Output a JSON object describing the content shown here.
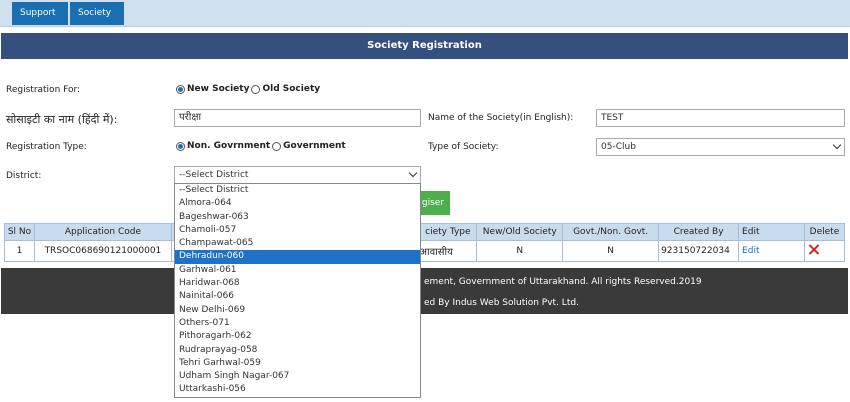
{
  "nav": {
    "support": "Support",
    "society": "Society"
  },
  "page_title": "Society Registration",
  "form": {
    "registration_for_label": "Registration For:",
    "registration_for_options": [
      "New Society",
      "Old Society"
    ],
    "registration_for_selected": "New Society",
    "name_hindi_label": "सोसाइटी का नाम (हिंदी में):",
    "name_hindi_value": "परीक्षा",
    "name_english_label": "Name of the Society(in English):",
    "name_english_value": "TEST",
    "registration_type_label": "Registration Type:",
    "registration_type_options": [
      "Non. Govrnment",
      "Government"
    ],
    "registration_type_selected": "Non. Govrnment",
    "type_of_society_label": "Type of Society:",
    "type_of_society_value": "05-Club",
    "district_label": "District:",
    "district_value": "--Select District",
    "register_button": "giser"
  },
  "district_options": [
    "--Select District",
    "Almora-064",
    "Bageshwar-063",
    "Chamoli-057",
    "Champawat-065",
    "Dehradun-060",
    "Garhwal-061",
    "Haridwar-068",
    "Nainital-066",
    "New Delhi-069",
    "Others-071",
    "Pithoragarh-062",
    "Rudraprayag-058",
    "Tehri Garhwal-059",
    "Udham Singh Nagar-067",
    "Uttarkashi-056"
  ],
  "district_highlighted": "Dehradun-060",
  "table": {
    "headers": [
      "Sl No",
      "Application Code",
      "",
      "ciety Type",
      "New/Old Society",
      "Govt./Non. Govt.",
      "Created By",
      "Edit",
      "Delete"
    ],
    "rows": [
      {
        "sl": "1",
        "code": "TRSOC068690121000001",
        "society_type": "आवासीय",
        "new_old": "N",
        "govt": "N",
        "created_by": "923150722034",
        "edit": "Edit"
      }
    ]
  },
  "footer": {
    "line1": "ement, Government of Uttarakhand. All rights Reserved.2019",
    "line2": "ed By Indus Web Solution Pvt. Ltd."
  },
  "colors": {
    "nav_button": "#1a6fb3",
    "title_bar": "#34507e",
    "register_button": "#4cae4c",
    "footer": "#3a3a3a",
    "highlight": "#1e73c8",
    "delete_icon": "#d42222"
  }
}
